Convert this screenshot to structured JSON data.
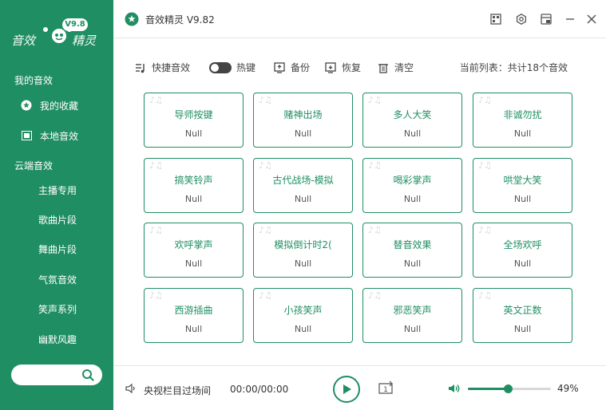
{
  "app": {
    "title": "音效精灵 V9.82",
    "logo_left": "音效",
    "logo_right": "精灵",
    "logo_version": "V9.8"
  },
  "sidebar": {
    "section_mine": "我的音效",
    "favorites": "我的收藏",
    "local": "本地音效",
    "section_cloud": "云端音效",
    "items": [
      "主播专用",
      "歌曲片段",
      "舞曲片段",
      "气氛音效",
      "笑声系列",
      "幽默风趣"
    ]
  },
  "toolbar": {
    "quick": "快捷音效",
    "hotkey": "热键",
    "backup": "备份",
    "restore": "恢复",
    "clear": "清空",
    "list_info": "当前列表：共计18个音效"
  },
  "cards": [
    {
      "name": "导师按键",
      "sub": "Null"
    },
    {
      "name": "赌神出场",
      "sub": "Null"
    },
    {
      "name": "多人大笑",
      "sub": "Null"
    },
    {
      "name": "非诚勿扰",
      "sub": "Null"
    },
    {
      "name": "搞笑铃声",
      "sub": "Null"
    },
    {
      "name": "古代战场-模拟",
      "sub": "Null"
    },
    {
      "name": "喝彩掌声",
      "sub": "Null"
    },
    {
      "name": "哄堂大笑",
      "sub": "Null"
    },
    {
      "name": "欢呼掌声",
      "sub": "Null"
    },
    {
      "name": "模拟倒计时2(",
      "sub": "Null"
    },
    {
      "name": "替音效果",
      "sub": "Null"
    },
    {
      "name": "全场欢呼",
      "sub": "Null"
    },
    {
      "name": "西游插曲",
      "sub": "Null"
    },
    {
      "name": "小孩笑声",
      "sub": "Null"
    },
    {
      "name": "邪恶笑声",
      "sub": "Null"
    },
    {
      "name": "英文正数",
      "sub": "Null"
    }
  ],
  "player": {
    "track": "央视栏目过场间",
    "time": "00:00/00:00",
    "loop_label": "1",
    "volume": 0.49,
    "volume_text": "49%"
  },
  "colors": {
    "accent": "#1f8e63"
  }
}
